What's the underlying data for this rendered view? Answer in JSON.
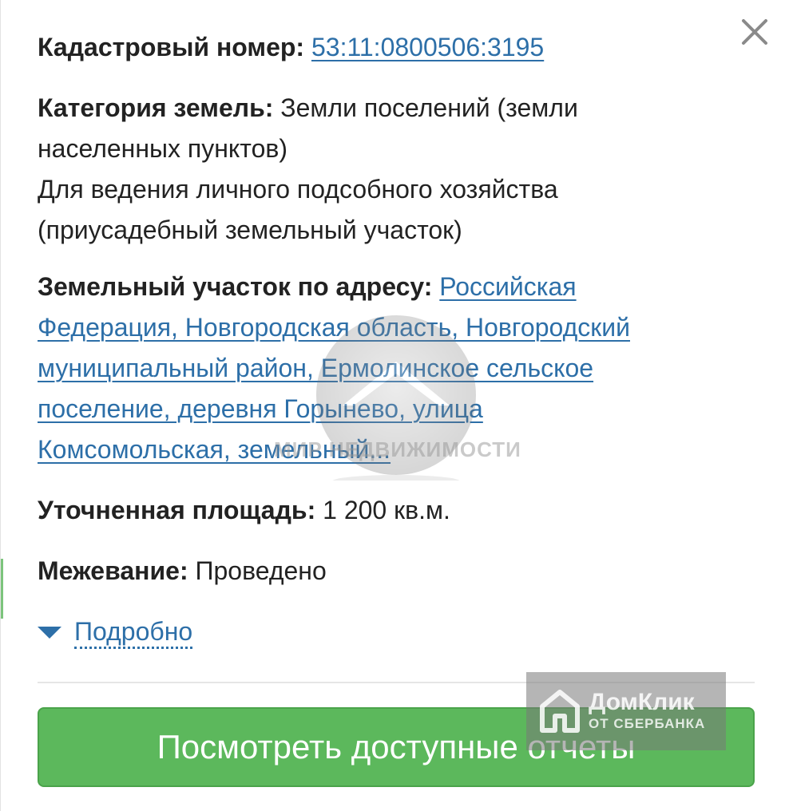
{
  "close": {
    "icon": "close-icon"
  },
  "cadastral": {
    "label": "Кадастровый номер:",
    "value": "53:11:0800506:3195"
  },
  "category": {
    "label": "Категория земель:",
    "line1": "Земли поселений (земли",
    "line2": "населенных пунктов)",
    "line3": "Для ведения личного подсобного хозяйства",
    "line4": "(приусадебный земельный участок)"
  },
  "address": {
    "label": "Земельный участок по адресу:",
    "line1": "Российская",
    "line2": "Федерация, Новгородская область, Новгородский",
    "line3": "муниципальный район, Ермолинское сельское",
    "line4": "поселение, деревня Горынево, улица",
    "line5": "Комсомольская, земельный..."
  },
  "area": {
    "label": "Уточненная площадь:",
    "value": "1 200 кв.м."
  },
  "survey": {
    "label": "Межевание:",
    "value": "Проведено"
  },
  "more": {
    "label": "Подробно",
    "icon": "triangle-down-icon"
  },
  "action": {
    "label": "Посмотреть доступные отчеты"
  },
  "watermark": {
    "text": "МИР НЕДВИЖИМОСТИ"
  },
  "badge": {
    "name": "ДомКлик",
    "sub": "ОТ СБЕРБАНКА"
  },
  "colors": {
    "link": "#2d6fa8",
    "button": "#5cb85c",
    "text": "#222222"
  }
}
